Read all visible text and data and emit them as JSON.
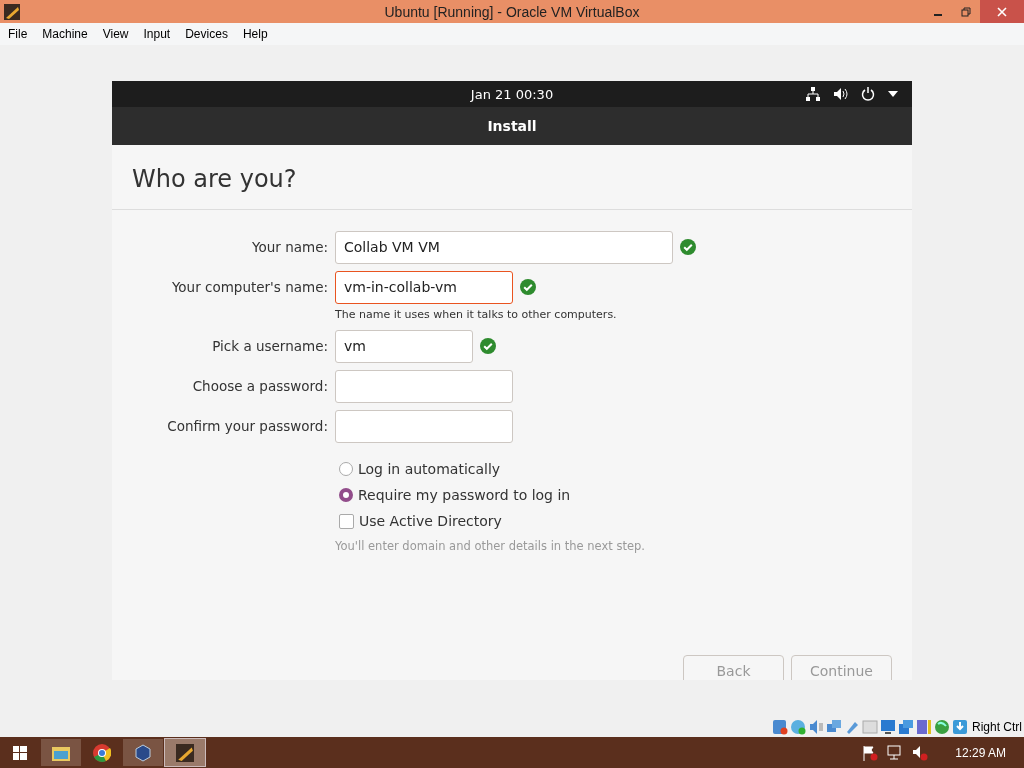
{
  "window": {
    "title": "Ubuntu [Running] - Oracle VM VirtualBox"
  },
  "menu": [
    "File",
    "Machine",
    "View",
    "Input",
    "Devices",
    "Help"
  ],
  "guest_top_bar": {
    "clock": "Jan 21  00:30"
  },
  "header": {
    "title": "Install"
  },
  "page_title": "Who are you?",
  "fields": [
    {
      "label": "Your name:",
      "value": "Collab VM VM",
      "kind": "wide",
      "focused": false,
      "valid": true
    },
    {
      "label": "Your computer's name:",
      "value": "vm-in-collab-vm",
      "kind": "medium",
      "focused": true,
      "valid": true,
      "hint": "The name it uses when it talks to other computers."
    },
    {
      "label": "Pick a username:",
      "value": "vm",
      "kind": "short",
      "focused": false,
      "valid": true
    },
    {
      "label": "Choose a password:",
      "kind": "medium",
      "focused": false,
      "valid": false
    },
    {
      "label": "Confirm your password:",
      "kind": "medium",
      "focused": false,
      "valid": false
    }
  ],
  "login_options": [
    {
      "label": "Log in automatically",
      "selected": false
    },
    {
      "label": "Require my password to log in",
      "selected": true
    }
  ],
  "active_directory": {
    "label": "Use Active Directory",
    "checked": false,
    "hint": "You'll enter domain and other details in the next step."
  },
  "buttons": [
    {
      "label": "Back"
    },
    {
      "label": "Continue"
    }
  ],
  "host_key": "Right Ctrl",
  "taskbar": {
    "time": "12:29 AM"
  }
}
